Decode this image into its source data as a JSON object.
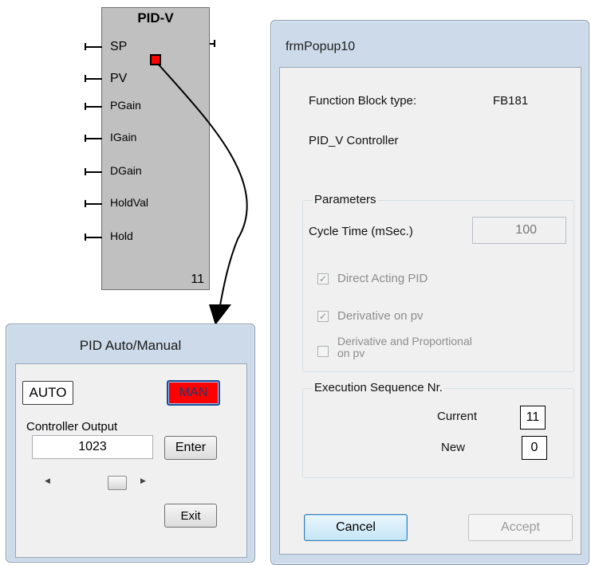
{
  "function_block": {
    "title": "PID-V",
    "inputs": [
      "SP",
      "PV",
      "PGain",
      "IGain",
      "DGain",
      "HoldVal",
      "Hold"
    ],
    "execution_number": "11",
    "marker_color": "#ff0000"
  },
  "pid_window": {
    "title": "PID Auto/Manual",
    "auto_label": "AUTO",
    "man_label": "MAN",
    "output_label": "Controller Output",
    "output_value": "1023",
    "enter_label": "Enter",
    "exit_label": "Exit"
  },
  "popup": {
    "title": "frmPopup10",
    "fb_type_label": "Function Block type:",
    "fb_type_value": "FB181",
    "controller_name": "PID_V Controller",
    "parameters_legend": "Parameters",
    "cycle_time_label": "Cycle Time (mSec.)",
    "cycle_time_value": "100",
    "direct_acting_label": "Direct Acting PID",
    "direct_acting_checked": true,
    "derivative_pv_label": "Derivative on pv",
    "derivative_pv_checked": true,
    "derivative_prop_label_line1": "Derivative and Proportional",
    "derivative_prop_label_line2": "on pv",
    "derivative_prop_checked": false,
    "exec_legend": "Execution Sequence Nr.",
    "current_label": "Current",
    "current_value": "11",
    "new_label": "New",
    "new_value": "0",
    "cancel_label": "Cancel",
    "accept_label": "Accept"
  },
  "colors": {
    "block_fill": "#c0c0c0",
    "man_active": "#ff0000",
    "window_frame": "#ccdaea"
  }
}
